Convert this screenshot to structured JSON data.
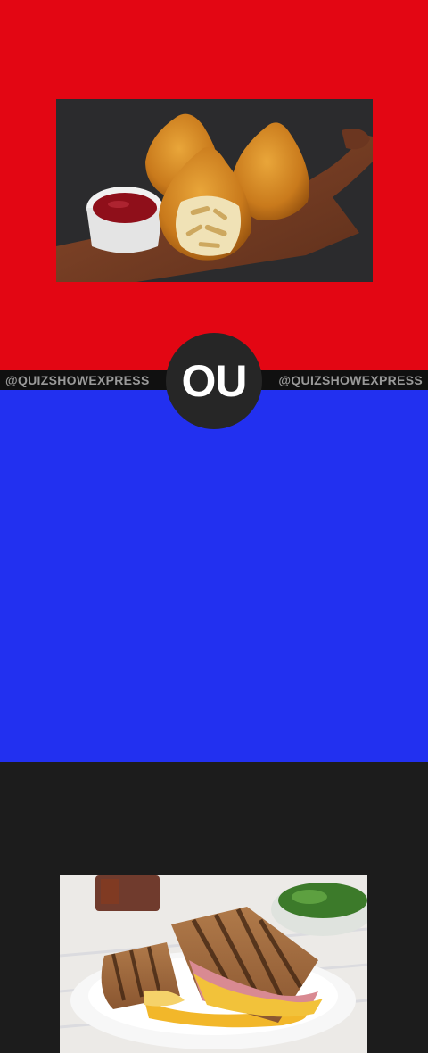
{
  "colors": {
    "top_panel": "#e30613",
    "bottom_panel": "#2230f0",
    "divider": "#101010",
    "badge": "#262626"
  },
  "divider": {
    "handle_left": "@QUIZSHOWEXPRESS",
    "handle_right": "@QUIZSHOWEXPRESS"
  },
  "badge": {
    "label": "OU"
  },
  "option_top": {
    "image": "coxinha-photo"
  },
  "option_bottom": {
    "image": "grilled-ham-cheese-sandwich-photo"
  }
}
